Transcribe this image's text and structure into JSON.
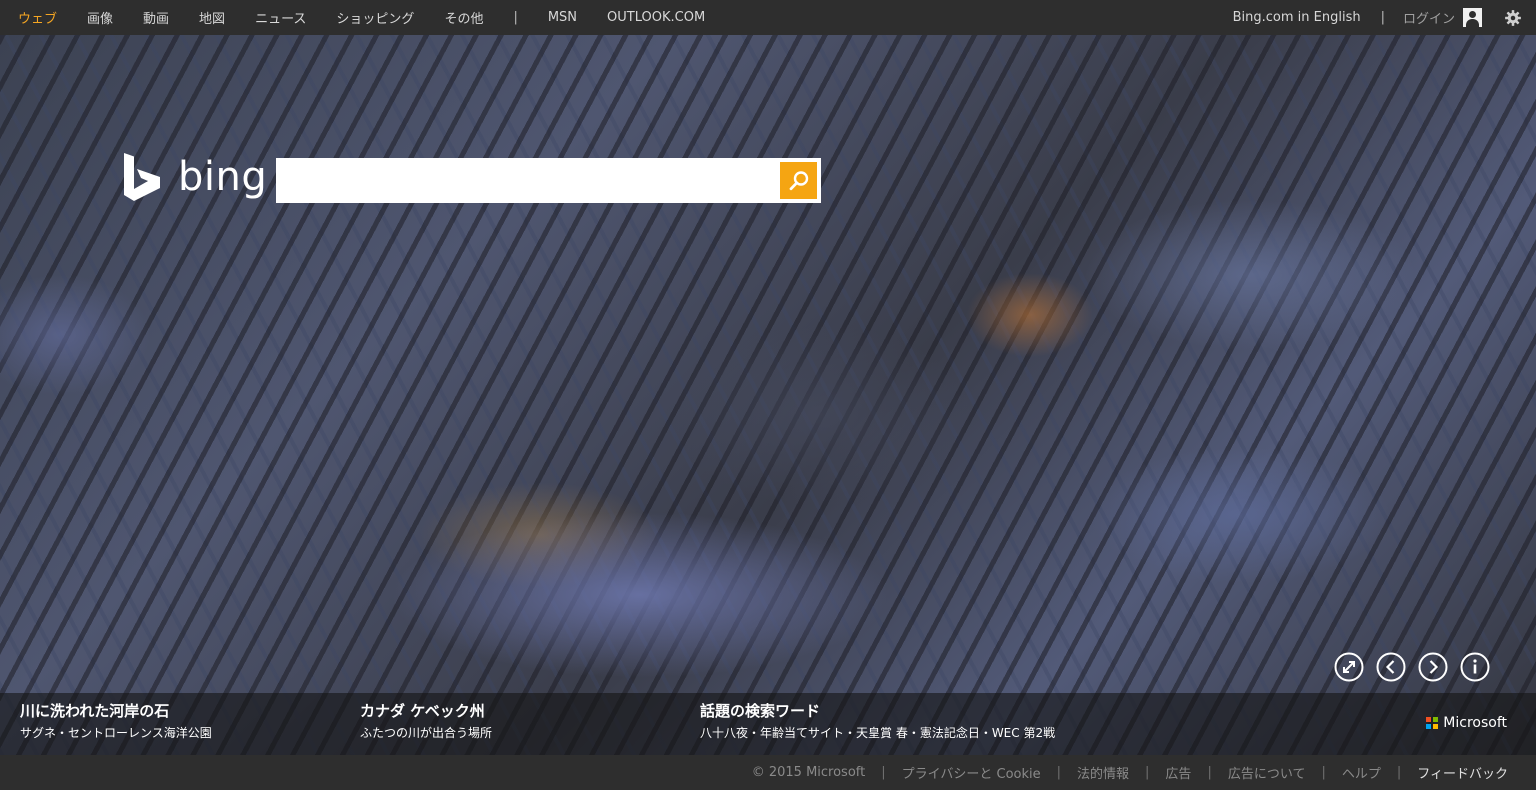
{
  "topnav": {
    "items": [
      {
        "label": "ウェブ",
        "active": true
      },
      {
        "label": "画像"
      },
      {
        "label": "動画"
      },
      {
        "label": "地図"
      },
      {
        "label": "ニュース"
      },
      {
        "label": "ショッピング"
      },
      {
        "label": "その他"
      }
    ],
    "separator": "|",
    "extra": [
      {
        "label": "MSN"
      },
      {
        "label": "OUTLOOK.COM"
      }
    ],
    "lang_link": "Bing.com in English",
    "right_separator": "|",
    "login": "ログイン",
    "icons": {
      "avatar": "user-avatar-icon",
      "settings": "gear-icon"
    }
  },
  "logo": {
    "text": "bing"
  },
  "search": {
    "value": "",
    "placeholder": "",
    "button_icon": "search-icon",
    "button_color": "#f5a512"
  },
  "controls": [
    {
      "name": "fullscreen-button",
      "icon": "expand-icon"
    },
    {
      "name": "previous-image-button",
      "icon": "chevron-left-icon"
    },
    {
      "name": "next-image-button",
      "icon": "chevron-right-icon"
    },
    {
      "name": "info-button",
      "icon": "info-icon"
    }
  ],
  "captions": [
    {
      "title": "川に洗われた河岸の石",
      "subtitle": "サグネ・セントローレンス海洋公園"
    },
    {
      "title": "カナダ ケベック州",
      "subtitle": "ふたつの川が出合う場所"
    },
    {
      "title": "話題の検索ワード",
      "subtitle": "八十八夜・年齢当てサイト・天皇賞 春・憲法記念日・WEC 第2戦"
    }
  ],
  "microsoft": {
    "text": "Microsoft",
    "colors": [
      "#f25022",
      "#7fba00",
      "#00a4ef",
      "#ffb900"
    ]
  },
  "footer": {
    "copyright": "© 2015 Microsoft",
    "links": [
      {
        "label": "プライバシーと Cookie"
      },
      {
        "label": "法的情報"
      },
      {
        "label": "広告"
      },
      {
        "label": "広告について"
      },
      {
        "label": "ヘルプ"
      },
      {
        "label": "フィードバック",
        "bright": true
      }
    ],
    "separator": "|"
  },
  "colors": {
    "accent": "#f5a623",
    "bar_bg": "#2e2e2e"
  }
}
